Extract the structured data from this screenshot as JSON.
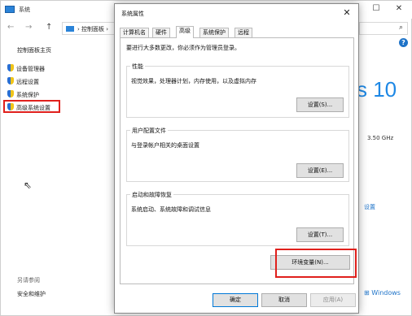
{
  "background_window": {
    "title": "系统",
    "breadcrumb": "控制面板",
    "sidebar": {
      "home": "控制面板主页",
      "items": [
        "设备管理器",
        "远程设置",
        "系统保护",
        "高级系统设置"
      ],
      "see_also": "另请参阅",
      "security": "安全和维护"
    },
    "partial_texts": {
      "windows_version": "s 10",
      "cpu_speed": "3.50 GHz",
      "settings_link": "设置",
      "windows_link": "Windows"
    }
  },
  "dialog": {
    "title": "系统属性",
    "tabs": [
      "计算机名",
      "硬件",
      "高级",
      "系统保护",
      "远程"
    ],
    "active_tab": "高级",
    "admin_note": "要进行大多数更改，你必须作为管理员登录。",
    "groups": [
      {
        "legend": "性能",
        "description": "视觉效果，处理器计划，内存使用，以及虚拟内存",
        "button": "设置(S)..."
      },
      {
        "legend": "用户配置文件",
        "description": "与登录帐户相关的桌面设置",
        "button": "设置(E)..."
      },
      {
        "legend": "启动和故障恢复",
        "description": "系统启动、系统故障和调试信息",
        "button": "设置(T)..."
      }
    ],
    "env_button": "环境变量(N)...",
    "footer": {
      "ok": "确定",
      "cancel": "取消",
      "apply": "应用(A)"
    }
  },
  "icons": {
    "close": "close-icon",
    "shield": "shield-icon",
    "help": "help-icon",
    "search": "search-icon"
  },
  "colors": {
    "accent": "#1e73c8",
    "highlight": "#e0201c"
  }
}
